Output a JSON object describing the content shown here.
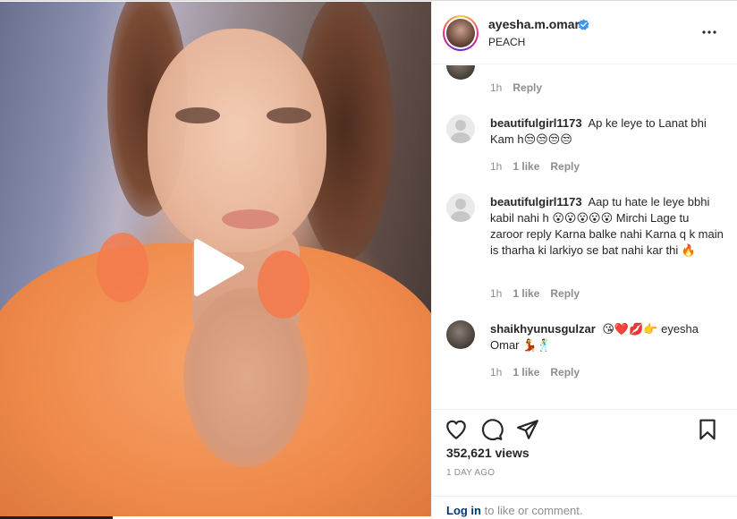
{
  "post": {
    "username": "ayesha.m.omar",
    "location": "PEACH",
    "views": "352,621 views",
    "time_ago": "1 DAY AGO",
    "login_link": "Log in",
    "login_rest": " to like or comment."
  },
  "comments": [
    {
      "username": "",
      "text": "",
      "time": "1h",
      "likes": "",
      "reply": "Reply"
    },
    {
      "username": "beautifulgirl1173",
      "text": "Ap ke leye to Lanat bhi Kam h😒😒😒😒",
      "time": "1h",
      "likes": "1 like",
      "reply": "Reply"
    },
    {
      "username": "beautifulgirl1173",
      "text": "Aap tu hate le leye bbhi kabil nahi h 😮😮😮😮😮 Mirchi Lage tu zaroor reply Karna balke nahi Karna q k main is tharha ki larkiyo se bat nahi kar thi 🔥",
      "time": "1h",
      "likes": "1 like",
      "reply": "Reply"
    },
    {
      "username": "shaikhyunusgulzar",
      "text": "😘❤️💋👉 eyesha Omar 💃🕺",
      "time": "1h",
      "likes": "1 like",
      "reply": "Reply"
    }
  ],
  "icons": {
    "verified": "verified-badge-icon",
    "more": "more-options-icon",
    "play": "play-icon",
    "like": "heart-icon",
    "comment": "comment-bubble-icon",
    "share": "paper-plane-icon",
    "save": "bookmark-icon"
  },
  "colors": {
    "accent": "#0095f6",
    "link": "#00376b",
    "muted": "#8e8e8e",
    "text": "#262626"
  }
}
